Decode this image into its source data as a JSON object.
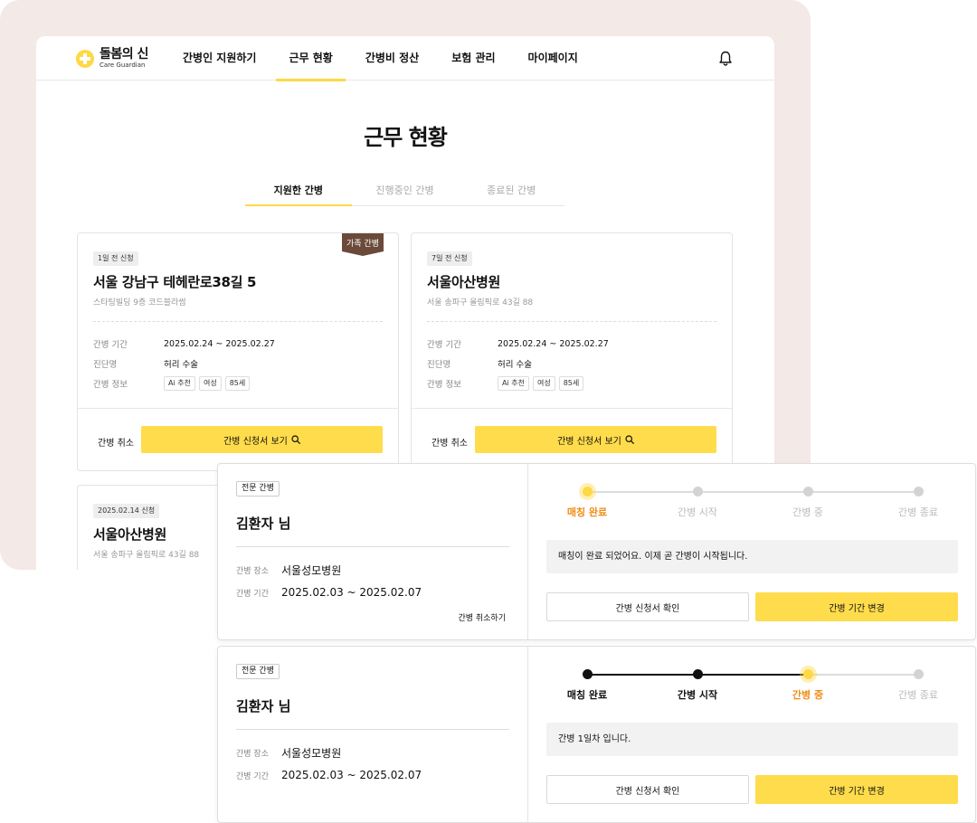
{
  "brand": {
    "name": "돌봄의 신",
    "sub": "Care Guardian"
  },
  "nav": {
    "items": [
      "간병인 지원하기",
      "근무 현황",
      "간병비 정산",
      "보험 관리",
      "마이페이지"
    ],
    "active_index": 1,
    "bell_icon": "bell-icon"
  },
  "page": {
    "title": "근무 현황"
  },
  "tabs": {
    "items": [
      "지원한 간병",
      "진행중인 간병",
      "종료된 간병"
    ],
    "active_index": 0
  },
  "cards": [
    {
      "badge": "1일 전 신청",
      "ribbon": "가족 간병",
      "title": "서울 강남구 테헤란로38길 5",
      "subtitle": "스타팅빌딩 9층 코드블라썸",
      "period_label": "간병 기간",
      "period": "2025.02.24 ~ 2025.02.27",
      "diagnosis_label": "진단명",
      "diagnosis": "허리 수술",
      "info_label": "간병 정보",
      "tags": [
        "Ai 추천",
        "여성",
        "85세"
      ],
      "cancel": "간병 취소",
      "view": "간병 신청서 보기"
    },
    {
      "badge": "7일 전 신청",
      "title": "서울아산병원",
      "subtitle": "서울 송파구 올림픽로 43길 88",
      "period_label": "간병 기간",
      "period": "2025.02.24 ~ 2025.02.27",
      "diagnosis_label": "진단명",
      "diagnosis": "허리 수술",
      "info_label": "간병 정보",
      "tags": [
        "Ai 추천",
        "여성",
        "85세"
      ],
      "cancel": "간병 취소",
      "view": "간병 신청서 보기"
    },
    {
      "badge": "2025.02.14 신청",
      "title": "서울아산병원",
      "subtitle": "서울 송파구 올림픽로 43길 88"
    }
  ],
  "panels": [
    {
      "chip": "전문 간병",
      "name": "김환자 님",
      "place_label": "간병 장소",
      "place": "서울성모병원",
      "period_label": "간병 기간",
      "period": "2025.02.03 ~ 2025.02.07",
      "cancel": "간병 취소하기",
      "steps": [
        "매칭 완료",
        "간병 시작",
        "간병 중",
        "간병 종료"
      ],
      "current_step": 0,
      "message": "매칭이 완료 되었어요. 이제 곧 간병이 시작됩니다.",
      "btn_check": "간병 신청서 확인",
      "btn_change": "간병 기간 변경"
    },
    {
      "chip": "전문 간병",
      "name": "김환자 님",
      "place_label": "간병 장소",
      "place": "서울성모병원",
      "period_label": "간병 기간",
      "period": "2025.02.03 ~ 2025.02.07",
      "steps": [
        "매칭 완료",
        "간병 시작",
        "간병 중",
        "간병 종료"
      ],
      "current_step": 2,
      "message": "간병 1일차 입니다.",
      "btn_check": "간병 신청서 확인",
      "btn_change": "간병 기간 변경"
    }
  ],
  "colors": {
    "accent": "#ffdc4b",
    "current_step": "#f08c14",
    "ribbon": "#6b4a3a",
    "backdrop": "#f3e9e6"
  }
}
